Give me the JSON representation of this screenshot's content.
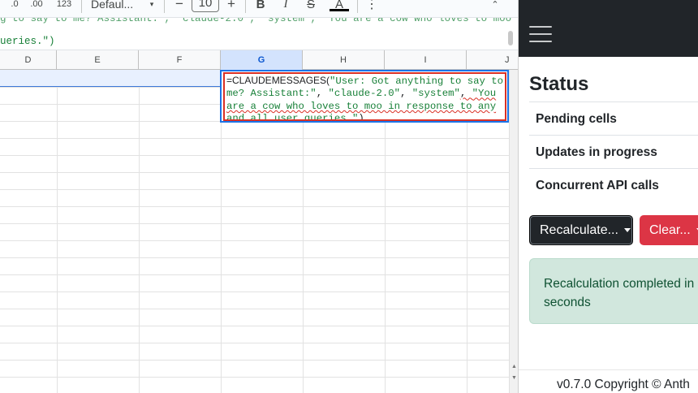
{
  "toolbar": {
    "decimal_decrease": ".0",
    "decimal_increase": ".00",
    "format_123": "123",
    "font_name": "Defaul...",
    "font_size": "10",
    "minus": "−",
    "plus": "+",
    "bold": "B",
    "italic": "I",
    "strike": "S",
    "text_color": "A",
    "more": "⋮"
  },
  "formula_bar": {
    "line1_fragment": "g to say to me? Assistant:\", \"claude-2.0\", \"system\", \"You are a cow who loves to moo",
    "line2_fragment": "ueries.\")"
  },
  "columns": [
    "D",
    "E",
    "F",
    "G",
    "H",
    "I",
    "J"
  ],
  "selected_column": "G",
  "cell_editor": {
    "function": "=CLAUDEMESSAGES(",
    "arg1": "\"User: Got anything to say to me? Assistant:\"",
    "sep1": ", ",
    "arg2": "\"claude-2.0\"",
    "sep2": ", ",
    "arg3": "\"system\"",
    "sep3": ", ",
    "arg4": "\"You are a cow who loves to moo in response to any and all user queries.\"",
    "close": ")"
  },
  "sidebar": {
    "title": "Status",
    "rows": [
      "Pending cells",
      "Updates in progress",
      "Concurrent API calls"
    ],
    "recalc_button": "Recalculate...",
    "clear_button": "Clear...",
    "alert": "Recalculation completed in seconds",
    "footer": "v0.7.0 Copyright © Anth"
  },
  "colors": {
    "accent": "#1a73e8",
    "string_green": "#188038",
    "error_red": "#d93025",
    "navbar": "#212529",
    "danger": "#dc3545",
    "success_bg": "#d1e7dd"
  }
}
